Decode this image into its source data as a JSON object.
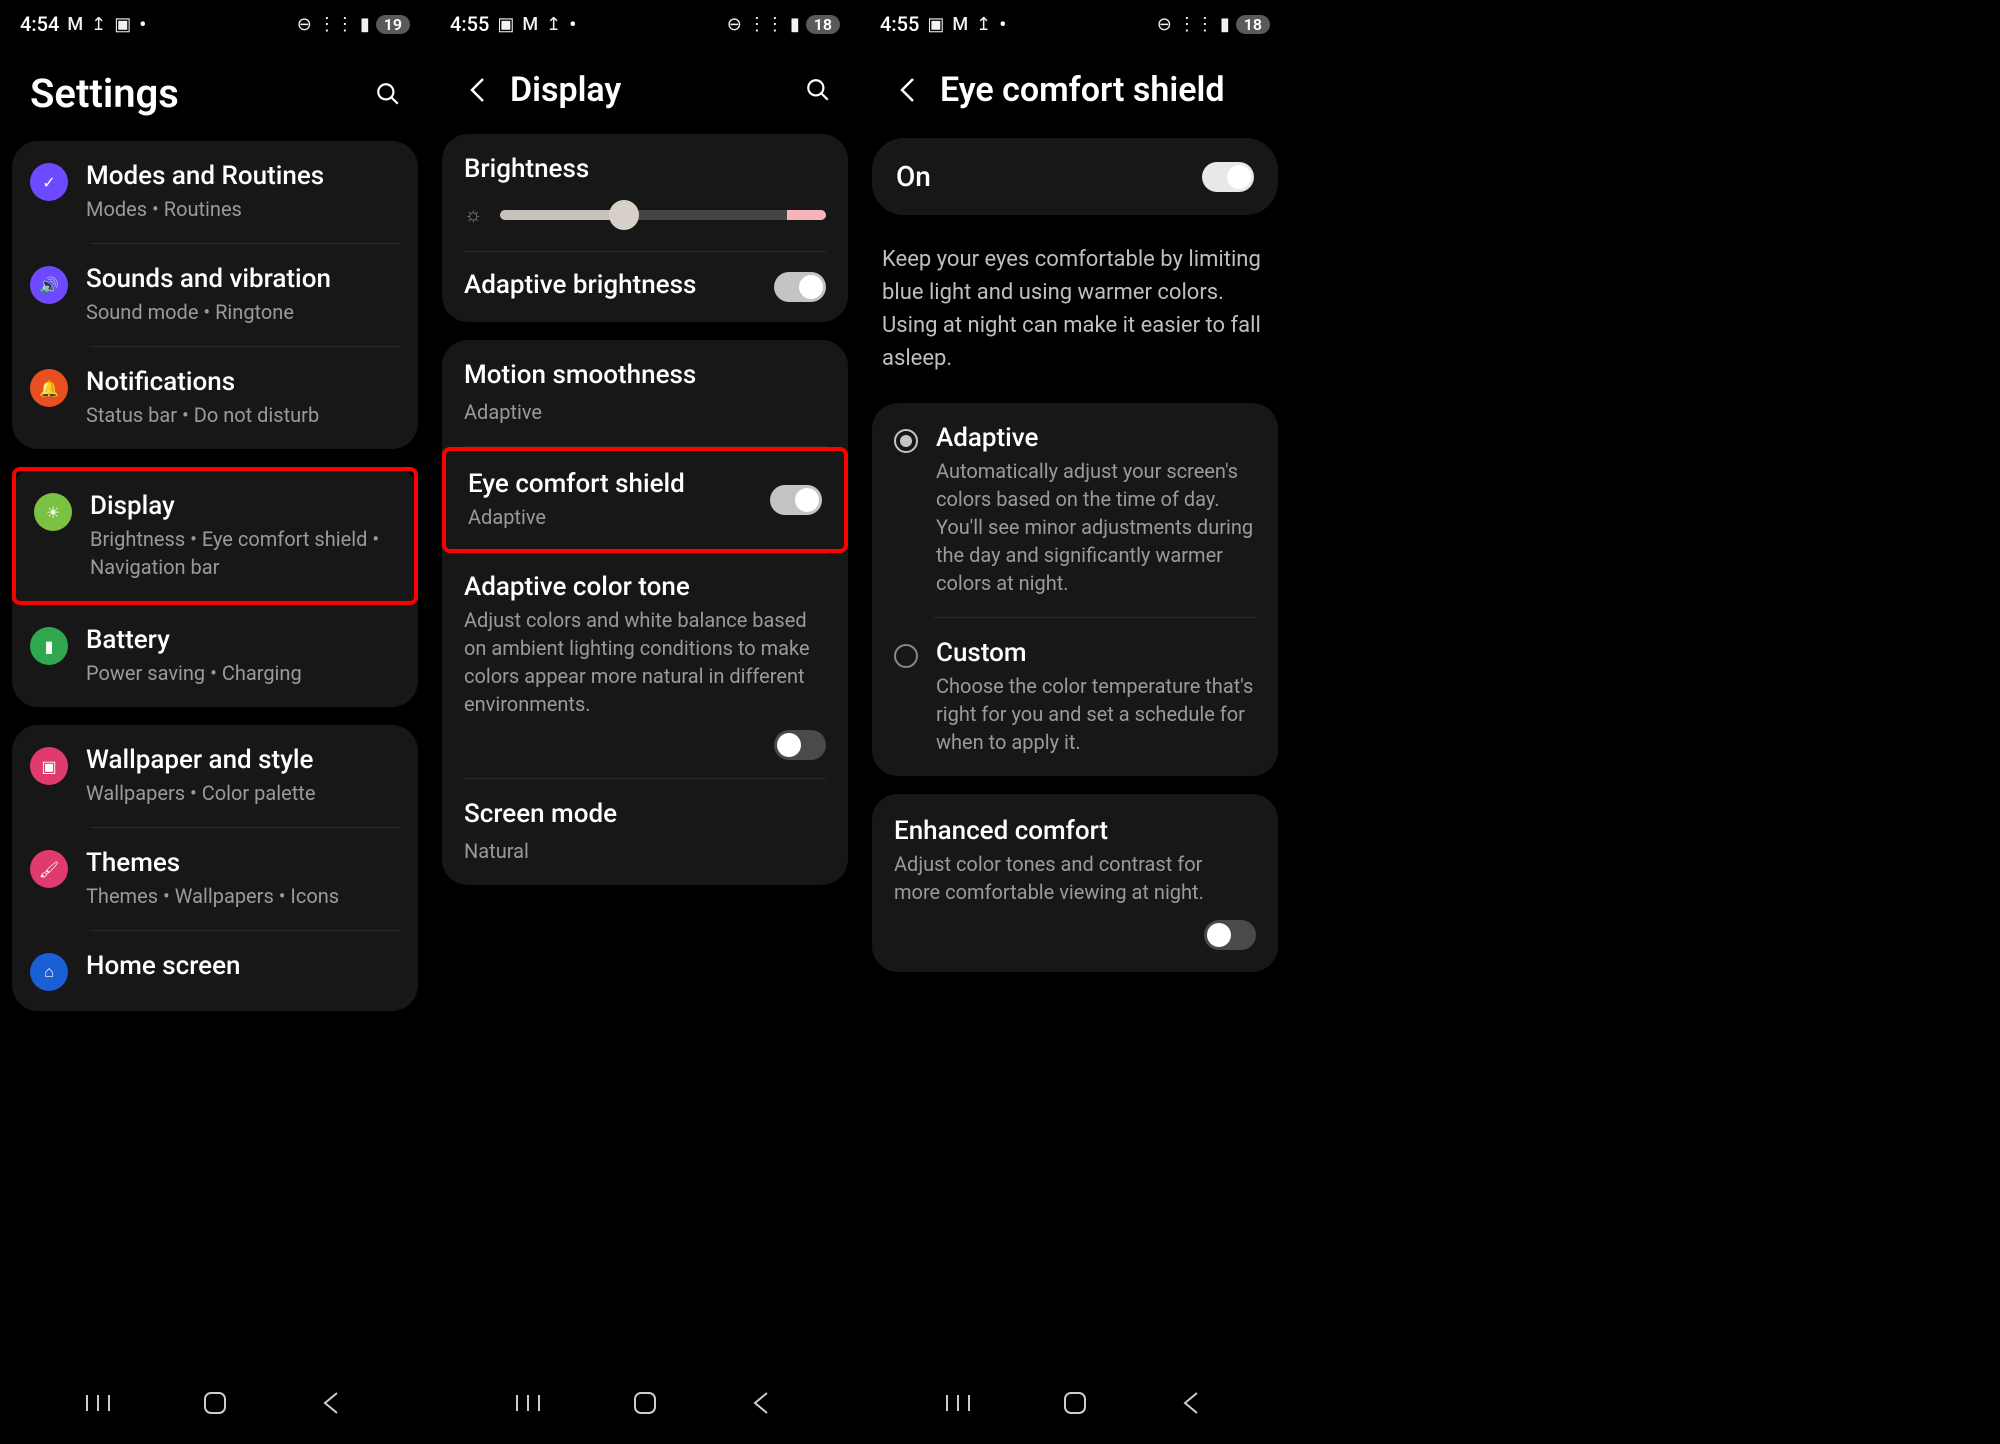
{
  "panel1": {
    "status": {
      "time": "4:54",
      "battery": "19"
    },
    "title": "Settings",
    "groups": [
      [
        {
          "icon_bg": "#6d4aff",
          "icon": "✓",
          "title": "Modes and Routines",
          "sub": "Modes  •  Routines"
        },
        {
          "icon_bg": "#6d4aff",
          "icon": "🔊",
          "title": "Sounds and vibration",
          "sub": "Sound mode  •  Ringtone"
        },
        {
          "icon_bg": "#e84f22",
          "icon": "🔔",
          "title": "Notifications",
          "sub": "Status bar  •  Do not disturb"
        }
      ],
      [
        {
          "icon_bg": "#7cc242",
          "icon": "☀",
          "title": "Display",
          "sub": "Brightness  •  Eye comfort shield  •  Navigation bar",
          "highlight": true
        },
        {
          "icon_bg": "#2fa84f",
          "icon": "▮",
          "title": "Battery",
          "sub": "Power saving  •  Charging"
        }
      ],
      [
        {
          "icon_bg": "#e03a6e",
          "icon": "🖼",
          "title": "Wallpaper and style",
          "sub": "Wallpapers  •  Color palette"
        },
        {
          "icon_bg": "#e03a6e",
          "icon": "🖌",
          "title": "Themes",
          "sub": "Themes  •  Wallpapers  •  Icons"
        },
        {
          "icon_bg": "#1a5fd6",
          "icon": "⌂",
          "title": "Home screen",
          "sub": ""
        }
      ]
    ]
  },
  "panel2": {
    "status": {
      "time": "4:55",
      "battery": "18"
    },
    "title": "Display",
    "brightness_label": "Brightness",
    "brightness_percent": 38,
    "adaptive_brightness": {
      "label": "Adaptive brightness",
      "on": true
    },
    "motion": {
      "title": "Motion smoothness",
      "value": "Adaptive"
    },
    "eye_shield": {
      "title": "Eye comfort shield",
      "value": "Adaptive",
      "on": true,
      "highlight": true
    },
    "color_tone": {
      "title": "Adaptive color tone",
      "desc": "Adjust colors and white balance based on ambient lighting conditions to make colors appear more natural in different environments.",
      "on": false
    },
    "screen_mode": {
      "title": "Screen mode",
      "value": "Natural"
    }
  },
  "panel3": {
    "status": {
      "time": "4:55",
      "battery": "18"
    },
    "title": "Eye comfort shield",
    "main_toggle": {
      "label": "On",
      "on": true
    },
    "info": "Keep your eyes comfortable by limiting blue light and using warmer colors. Using at night can make it easier to fall asleep.",
    "options": [
      {
        "title": "Adaptive",
        "desc": "Automatically adjust your screen's colors based on the time of day. You'll see minor adjustments during the day and significantly warmer colors at night.",
        "selected": true
      },
      {
        "title": "Custom",
        "desc": "Choose the color temperature that's right for you and set a schedule for when to apply it.",
        "selected": false
      }
    ],
    "enhanced": {
      "title": "Enhanced comfort",
      "desc": "Adjust color tones and contrast for more comfortable viewing at night.",
      "on": false
    }
  }
}
